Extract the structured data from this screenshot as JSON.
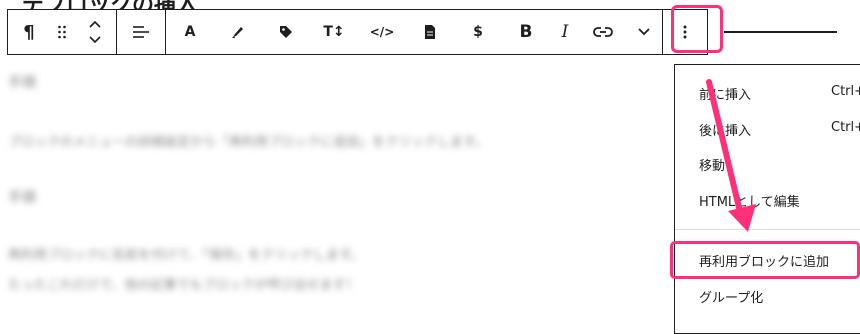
{
  "heading_fragment": "デプロックの挿入",
  "blurred_content": {
    "line1": "手順",
    "line2": "ブロックのメニューの詳細設定から「再利用ブロックに追加」をクリックします。",
    "line3": "手順",
    "line4": "再利用ブロックに名前を付けて、「保存」をクリックします。",
    "line5": "たったこれだけで、他の記事でもブロックが呼び出せます！"
  },
  "toolbar": {
    "paragraph": "¶",
    "align": "align-left-icon",
    "font": "A",
    "highlight": "marker-icon",
    "tag": "tag-icon",
    "text_size": "T↕",
    "code": "</>",
    "document": "document-icon",
    "dollar": "$",
    "bold": "B",
    "italic": "I",
    "link": "link-icon",
    "more": "chevron-down-icon",
    "options": "⋮"
  },
  "menu": {
    "items": [
      {
        "label": "前に挿入",
        "shortcut": "Ctrl+"
      },
      {
        "label": "後に挿入",
        "shortcut": "Ctrl+Alt"
      },
      {
        "label": "移動",
        "shortcut": ""
      },
      {
        "label": "HTMLとして編集",
        "shortcut": ""
      },
      {
        "label": "再利用ブロックに追加",
        "shortcut": ""
      },
      {
        "label": "グループ化",
        "shortcut": ""
      }
    ]
  },
  "colors": {
    "annotation": "#ff2f7a",
    "text": "#1e1e1e"
  }
}
